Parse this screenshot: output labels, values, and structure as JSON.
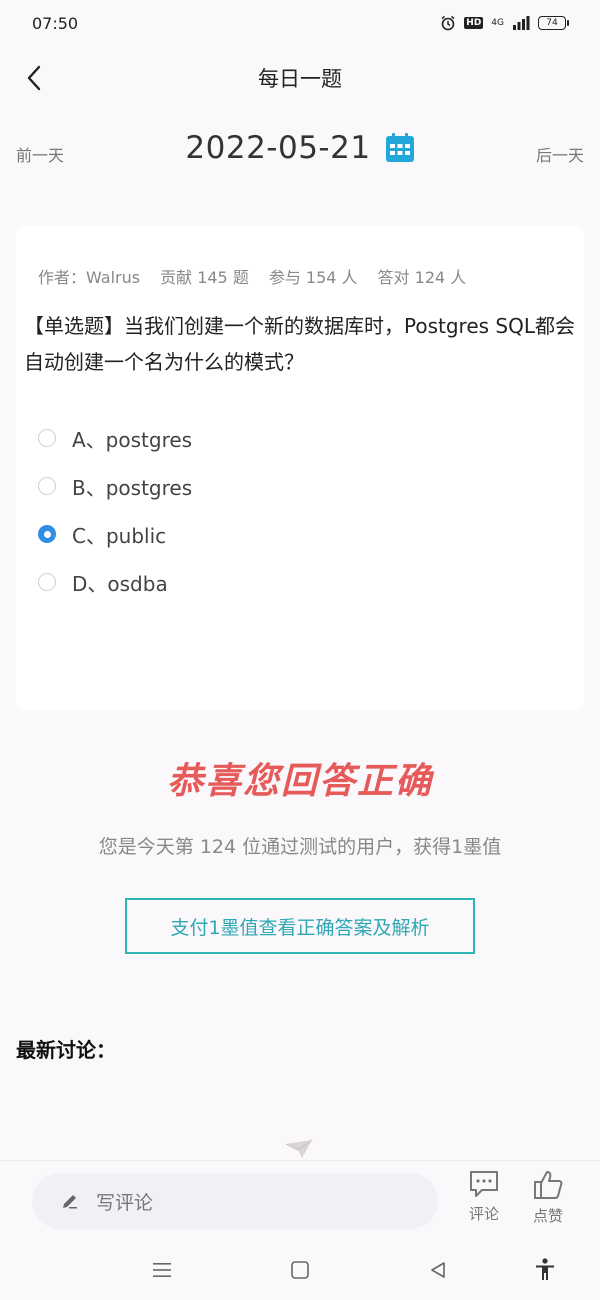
{
  "status_bar": {
    "time": "07:50",
    "hd": "HD",
    "network": "4G",
    "battery": "74"
  },
  "header": {
    "title": "每日一题"
  },
  "date_nav": {
    "prev": "前一天",
    "date": "2022-05-21",
    "next": "后一天"
  },
  "question": {
    "meta": {
      "author": "作者：Walrus",
      "contributed": "贡献 145 题",
      "participants": "参与 154 人",
      "correct": "答对 124 人"
    },
    "text": "【单选题】当我们创建一个新的数据库时，Postgres SQL都会自动创建一个名为什么的模式？",
    "options": [
      {
        "label": "A、postgres",
        "selected": false
      },
      {
        "label": "B、postgres",
        "selected": false
      },
      {
        "label": "C、public",
        "selected": true
      },
      {
        "label": "D、osdba",
        "selected": false
      }
    ]
  },
  "result": {
    "title": "恭喜您回答正确",
    "subtitle": "您是今天第 124 位通过测试的用户，获得1墨值",
    "pay_button": "支付1墨值查看正确答案及解析"
  },
  "discussion": {
    "title": "最新讨论："
  },
  "bottom_bar": {
    "comment_placeholder": "写评论",
    "comment_label": "评论",
    "like_label": "点赞"
  },
  "colors": {
    "accent_blue": "#2f8de4",
    "calendar_teal": "#21a7d9",
    "success_red": "#e65a5a",
    "button_teal": "#2fb5b5"
  }
}
